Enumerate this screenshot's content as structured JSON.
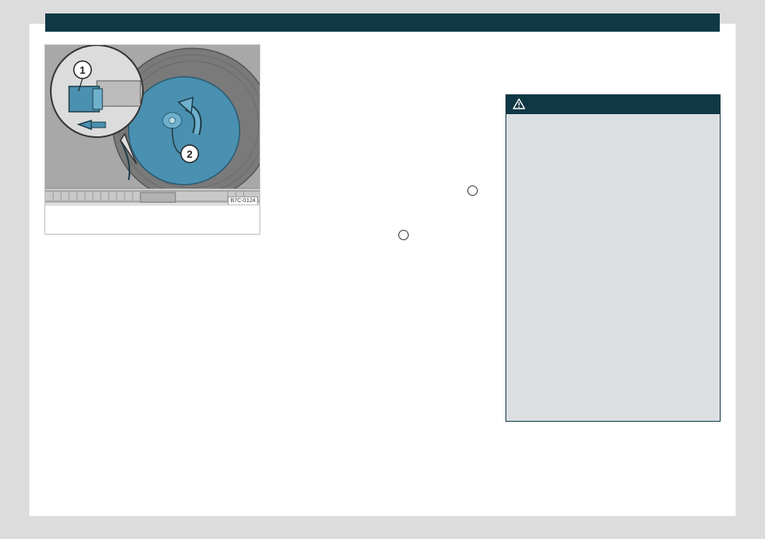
{
  "figure": {
    "code": "B7C-0124",
    "callouts": [
      "1",
      "2"
    ],
    "caption": ""
  },
  "icons": {
    "warning": "warning-triangle-icon",
    "reference_markers": "circle-reference-icon"
  },
  "colors": {
    "header": "#0f3844",
    "warning_bg": "#dbdfe2",
    "page_bg": "#ffffff",
    "surround": "#dcdcdc",
    "highlight_blue": "#4a90b0"
  }
}
